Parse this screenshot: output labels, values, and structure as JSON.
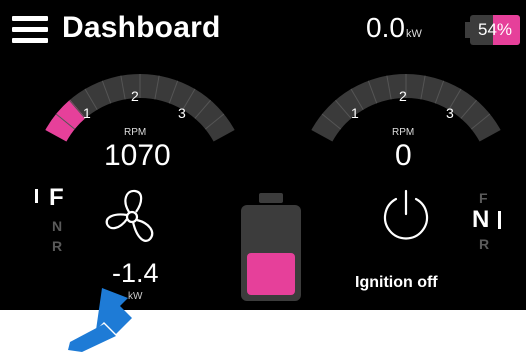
{
  "header": {
    "title": "Dashboard",
    "power_value": "0.0",
    "power_unit": "kW",
    "battery_percent": "54%",
    "battery_level": 0.54
  },
  "left_gauge": {
    "ticks": [
      "1",
      "2",
      "3"
    ],
    "rpm_label": "RPM",
    "rpm_value": "1070",
    "rpm_fraction": 0.17,
    "gears": {
      "forward": "F",
      "neutral": "N",
      "reverse": "R",
      "selected": "F"
    },
    "motor_icon": "propeller-icon",
    "motor_power": "-1.4",
    "motor_power_unit": "kW"
  },
  "center_battery": {
    "level": 0.5,
    "icon": "battery-icon"
  },
  "right_gauge": {
    "ticks": [
      "1",
      "2",
      "3"
    ],
    "rpm_label": "RPM",
    "rpm_value": "0",
    "rpm_fraction": 0.0,
    "gears": {
      "forward": "F",
      "neutral": "N",
      "reverse": "R",
      "selected": "N"
    },
    "ignition_icon": "power-icon",
    "ignition_label": "Ignition off"
  },
  "colors": {
    "accent": "#e6409a",
    "gauge_track": "#3a3a3a",
    "background": "#000000",
    "pointer_arrow": "#1e7bd6"
  }
}
